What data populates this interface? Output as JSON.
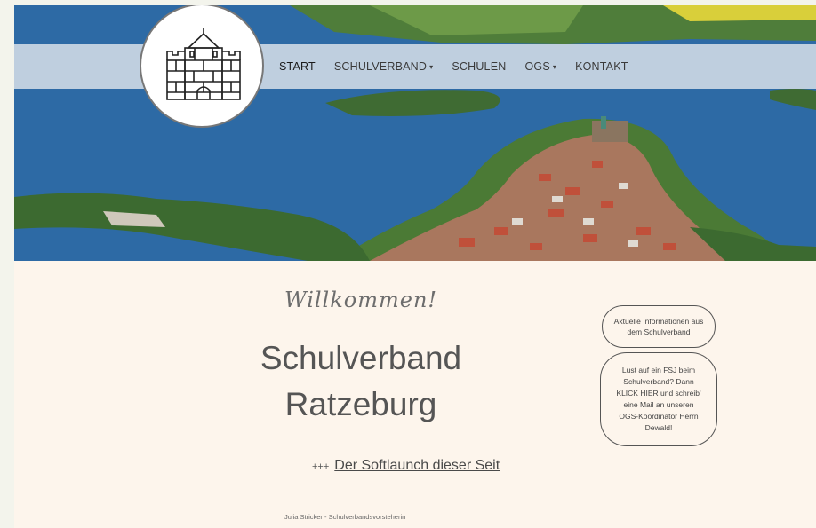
{
  "nav": {
    "items": [
      {
        "label": "START"
      },
      {
        "label": "SCHULVERBAND"
      },
      {
        "label": "SCHULEN"
      },
      {
        "label": "OGS"
      },
      {
        "label": "KONTAKT"
      }
    ],
    "caret": "▾"
  },
  "main": {
    "welcome": "Willkommen!",
    "title_line1": "Schulverband",
    "title_line2": "Ratzeburg",
    "news_prefix": "+++",
    "news_link": "Der Softlaunch dieser Seit",
    "signature": "Julia Stricker - Schulverbandsvorsteherin"
  },
  "sidebar": {
    "info_button": "Aktuelle Informationen aus dem Schulverband",
    "fsj_button": "Lust auf ein FSJ beim Schulverband? Dann KLICK HIER und schreib' eine Mail an unseren OGS-Koordinator Herrn Dewald!"
  },
  "colors": {
    "background": "#fdf5ec",
    "lake": "#2f6ea8",
    "navbar": "#e8ecf0",
    "text": "#555555"
  },
  "icons": {
    "logo": "town-coat-of-arms-tower"
  }
}
